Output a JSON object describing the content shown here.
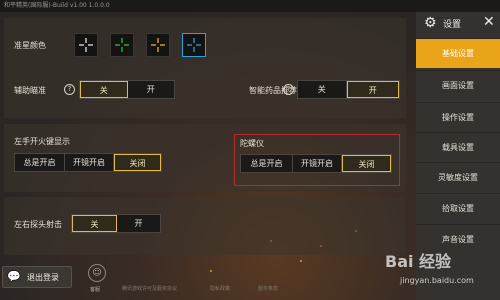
{
  "window": {
    "title": "和平精英(国际服)-Build v1.00  1.0.0.0"
  },
  "sidebar": {
    "title": "设置",
    "items": [
      {
        "label": "基础设置",
        "active": true
      },
      {
        "label": "画面设置",
        "active": false
      },
      {
        "label": "操作设置",
        "active": false
      },
      {
        "label": "载具设置",
        "active": false
      },
      {
        "label": "灵敏度设置",
        "active": false
      },
      {
        "label": "拾取设置",
        "active": false
      },
      {
        "label": "声音设置",
        "active": false
      }
    ]
  },
  "crosshair": {
    "label": "准星颜色",
    "options": [
      {
        "color": "#f2f2f2",
        "selected": false
      },
      {
        "color": "#2ecc40",
        "selected": false
      },
      {
        "color": "#f1c40f",
        "selected": false
      },
      {
        "color": "#3aa8e0",
        "selected": true
      }
    ]
  },
  "aim_assist": {
    "label": "辅助瞄准",
    "help": "?",
    "options": [
      "关",
      "开"
    ],
    "selected": "关"
  },
  "smart_meds": {
    "label": "智能药品推荐",
    "help": "?",
    "options": [
      "关",
      "开"
    ],
    "selected": "开"
  },
  "left_fire": {
    "label": "左手开火键显示",
    "options": [
      "总是开启",
      "开镜开启",
      "关闭"
    ],
    "selected": "关闭"
  },
  "gyro": {
    "label": "陀螺仪",
    "options": [
      "总是开启",
      "开镜开启",
      "关闭"
    ],
    "selected": "关闭"
  },
  "peek_fire": {
    "label": "左右探头射击",
    "options": [
      "关",
      "开"
    ],
    "selected": "关"
  },
  "footer": {
    "logout": "退出登录",
    "helper": "客服",
    "links": [
      "腾讯游戏许可及服务协议",
      "隐私政策",
      "服务条款"
    ]
  },
  "watermark": {
    "brand": "Bai  经验",
    "url": "jingyan.baidu.com"
  },
  "colors": {
    "accent": "#e9a419",
    "selected_border": "#e1b84a",
    "highlight_box": "#b52d2a"
  }
}
